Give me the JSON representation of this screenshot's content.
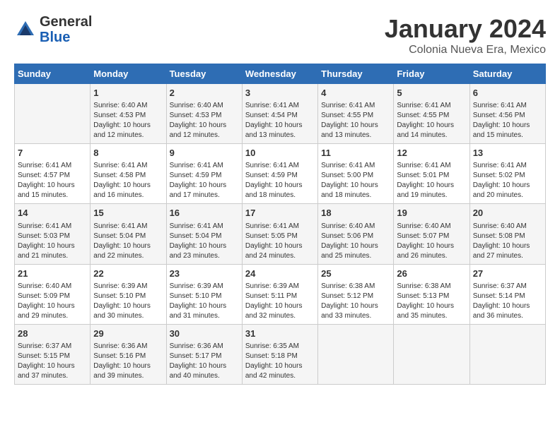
{
  "header": {
    "logo_general": "General",
    "logo_blue": "Blue",
    "month_title": "January 2024",
    "subtitle": "Colonia Nueva Era, Mexico"
  },
  "days_of_week": [
    "Sunday",
    "Monday",
    "Tuesday",
    "Wednesday",
    "Thursday",
    "Friday",
    "Saturday"
  ],
  "weeks": [
    [
      {
        "day": "",
        "detail": ""
      },
      {
        "day": "1",
        "detail": "Sunrise: 6:40 AM\nSunset: 4:53 PM\nDaylight: 10 hours\nand 12 minutes."
      },
      {
        "day": "2",
        "detail": "Sunrise: 6:40 AM\nSunset: 4:53 PM\nDaylight: 10 hours\nand 12 minutes."
      },
      {
        "day": "3",
        "detail": "Sunrise: 6:41 AM\nSunset: 4:54 PM\nDaylight: 10 hours\nand 13 minutes."
      },
      {
        "day": "4",
        "detail": "Sunrise: 6:41 AM\nSunset: 4:55 PM\nDaylight: 10 hours\nand 13 minutes."
      },
      {
        "day": "5",
        "detail": "Sunrise: 6:41 AM\nSunset: 4:55 PM\nDaylight: 10 hours\nand 14 minutes."
      },
      {
        "day": "6",
        "detail": "Sunrise: 6:41 AM\nSunset: 4:56 PM\nDaylight: 10 hours\nand 15 minutes."
      }
    ],
    [
      {
        "day": "7",
        "detail": "Sunrise: 6:41 AM\nSunset: 4:57 PM\nDaylight: 10 hours\nand 15 minutes."
      },
      {
        "day": "8",
        "detail": "Sunrise: 6:41 AM\nSunset: 4:58 PM\nDaylight: 10 hours\nand 16 minutes."
      },
      {
        "day": "9",
        "detail": "Sunrise: 6:41 AM\nSunset: 4:59 PM\nDaylight: 10 hours\nand 17 minutes."
      },
      {
        "day": "10",
        "detail": "Sunrise: 6:41 AM\nSunset: 4:59 PM\nDaylight: 10 hours\nand 18 minutes."
      },
      {
        "day": "11",
        "detail": "Sunrise: 6:41 AM\nSunset: 5:00 PM\nDaylight: 10 hours\nand 18 minutes."
      },
      {
        "day": "12",
        "detail": "Sunrise: 6:41 AM\nSunset: 5:01 PM\nDaylight: 10 hours\nand 19 minutes."
      },
      {
        "day": "13",
        "detail": "Sunrise: 6:41 AM\nSunset: 5:02 PM\nDaylight: 10 hours\nand 20 minutes."
      }
    ],
    [
      {
        "day": "14",
        "detail": "Sunrise: 6:41 AM\nSunset: 5:03 PM\nDaylight: 10 hours\nand 21 minutes."
      },
      {
        "day": "15",
        "detail": "Sunrise: 6:41 AM\nSunset: 5:04 PM\nDaylight: 10 hours\nand 22 minutes."
      },
      {
        "day": "16",
        "detail": "Sunrise: 6:41 AM\nSunset: 5:04 PM\nDaylight: 10 hours\nand 23 minutes."
      },
      {
        "day": "17",
        "detail": "Sunrise: 6:41 AM\nSunset: 5:05 PM\nDaylight: 10 hours\nand 24 minutes."
      },
      {
        "day": "18",
        "detail": "Sunrise: 6:40 AM\nSunset: 5:06 PM\nDaylight: 10 hours\nand 25 minutes."
      },
      {
        "day": "19",
        "detail": "Sunrise: 6:40 AM\nSunset: 5:07 PM\nDaylight: 10 hours\nand 26 minutes."
      },
      {
        "day": "20",
        "detail": "Sunrise: 6:40 AM\nSunset: 5:08 PM\nDaylight: 10 hours\nand 27 minutes."
      }
    ],
    [
      {
        "day": "21",
        "detail": "Sunrise: 6:40 AM\nSunset: 5:09 PM\nDaylight: 10 hours\nand 29 minutes."
      },
      {
        "day": "22",
        "detail": "Sunrise: 6:39 AM\nSunset: 5:10 PM\nDaylight: 10 hours\nand 30 minutes."
      },
      {
        "day": "23",
        "detail": "Sunrise: 6:39 AM\nSunset: 5:10 PM\nDaylight: 10 hours\nand 31 minutes."
      },
      {
        "day": "24",
        "detail": "Sunrise: 6:39 AM\nSunset: 5:11 PM\nDaylight: 10 hours\nand 32 minutes."
      },
      {
        "day": "25",
        "detail": "Sunrise: 6:38 AM\nSunset: 5:12 PM\nDaylight: 10 hours\nand 33 minutes."
      },
      {
        "day": "26",
        "detail": "Sunrise: 6:38 AM\nSunset: 5:13 PM\nDaylight: 10 hours\nand 35 minutes."
      },
      {
        "day": "27",
        "detail": "Sunrise: 6:37 AM\nSunset: 5:14 PM\nDaylight: 10 hours\nand 36 minutes."
      }
    ],
    [
      {
        "day": "28",
        "detail": "Sunrise: 6:37 AM\nSunset: 5:15 PM\nDaylight: 10 hours\nand 37 minutes."
      },
      {
        "day": "29",
        "detail": "Sunrise: 6:36 AM\nSunset: 5:16 PM\nDaylight: 10 hours\nand 39 minutes."
      },
      {
        "day": "30",
        "detail": "Sunrise: 6:36 AM\nSunset: 5:17 PM\nDaylight: 10 hours\nand 40 minutes."
      },
      {
        "day": "31",
        "detail": "Sunrise: 6:35 AM\nSunset: 5:18 PM\nDaylight: 10 hours\nand 42 minutes."
      },
      {
        "day": "",
        "detail": ""
      },
      {
        "day": "",
        "detail": ""
      },
      {
        "day": "",
        "detail": ""
      }
    ]
  ]
}
